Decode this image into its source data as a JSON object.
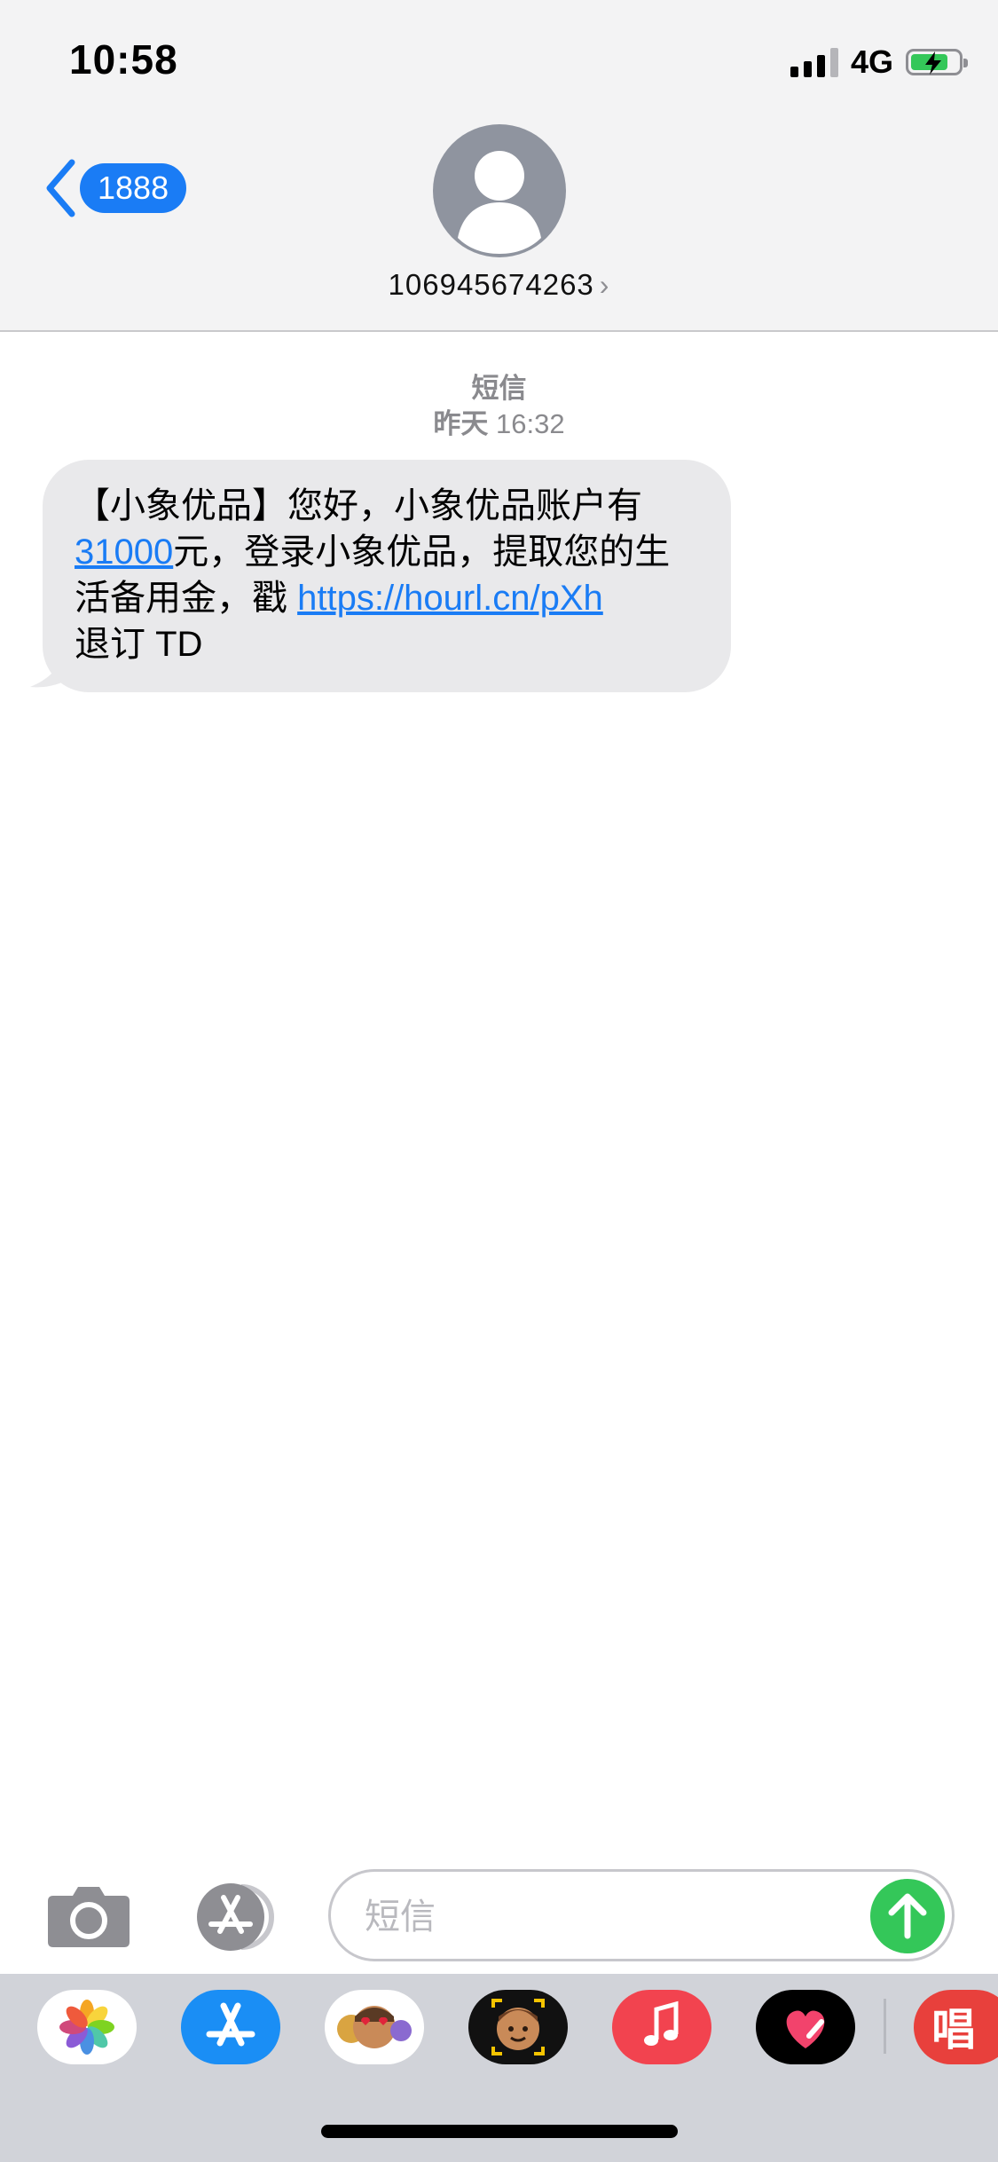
{
  "status_bar": {
    "time": "10:58",
    "network": "4G"
  },
  "nav": {
    "back_count": "1888",
    "contact_name": "106945674263",
    "contact_chevron": "›"
  },
  "conversation": {
    "service_label": "短信",
    "timestamp_day": "昨天",
    "timestamp_time": "16:32",
    "message": {
      "part1": "【小象优品】您好，小象优品账户有",
      "amount_link": "31000",
      "part2": "元，登录小象优品，提取您的生活备用金，戳 ",
      "url_link": "https://hourl.cn/pXh",
      "part3": "退订 TD"
    }
  },
  "input_bar": {
    "placeholder": "短信"
  },
  "app_drawer": {
    "apps": [
      "photos-app-icon",
      "app-store-app-icon",
      "memoji-stickers-app-icon",
      "animoji-app-icon",
      "music-app-icon",
      "digital-touch-app-icon",
      "karaoke-app-icon"
    ]
  },
  "colors": {
    "accent_blue": "#1a7cf5",
    "send_green": "#34c759",
    "bubble_gray": "#e9e9eb",
    "header_bg": "#f3f3f4"
  }
}
